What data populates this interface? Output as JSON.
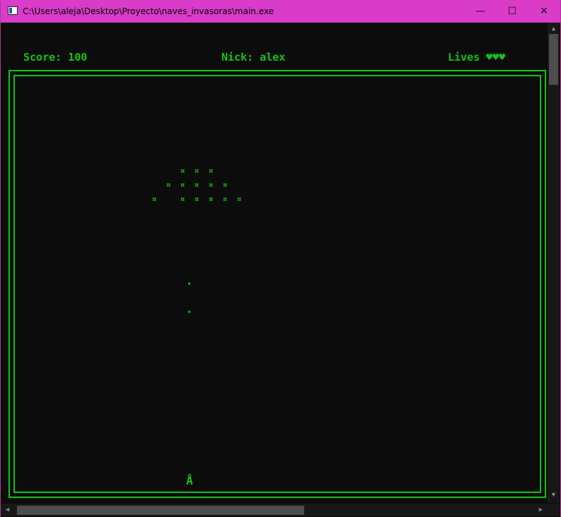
{
  "titlebar": {
    "title": "C:\\Users\\aleja\\Desktop\\Proyecto\\naves_invasoras\\main.exe",
    "minimize": "—",
    "maximize": "☐",
    "close": "✕"
  },
  "hud": {
    "score": "Score: 100",
    "nick": "Nick: alex",
    "lives": "Lives ♥♥♥"
  },
  "game": {
    "enemy_glyph": "¤",
    "player_glyph": "Å",
    "enemy_rows": [
      3,
      5,
      6
    ],
    "bullets": 2
  },
  "colors": {
    "foreground": "#13c413",
    "background": "#0c0c0c",
    "titlebar": "#d83cc8"
  },
  "icons": {
    "scroll_up": "▲",
    "scroll_down": "▼",
    "scroll_left": "◀",
    "scroll_right": "▶"
  }
}
